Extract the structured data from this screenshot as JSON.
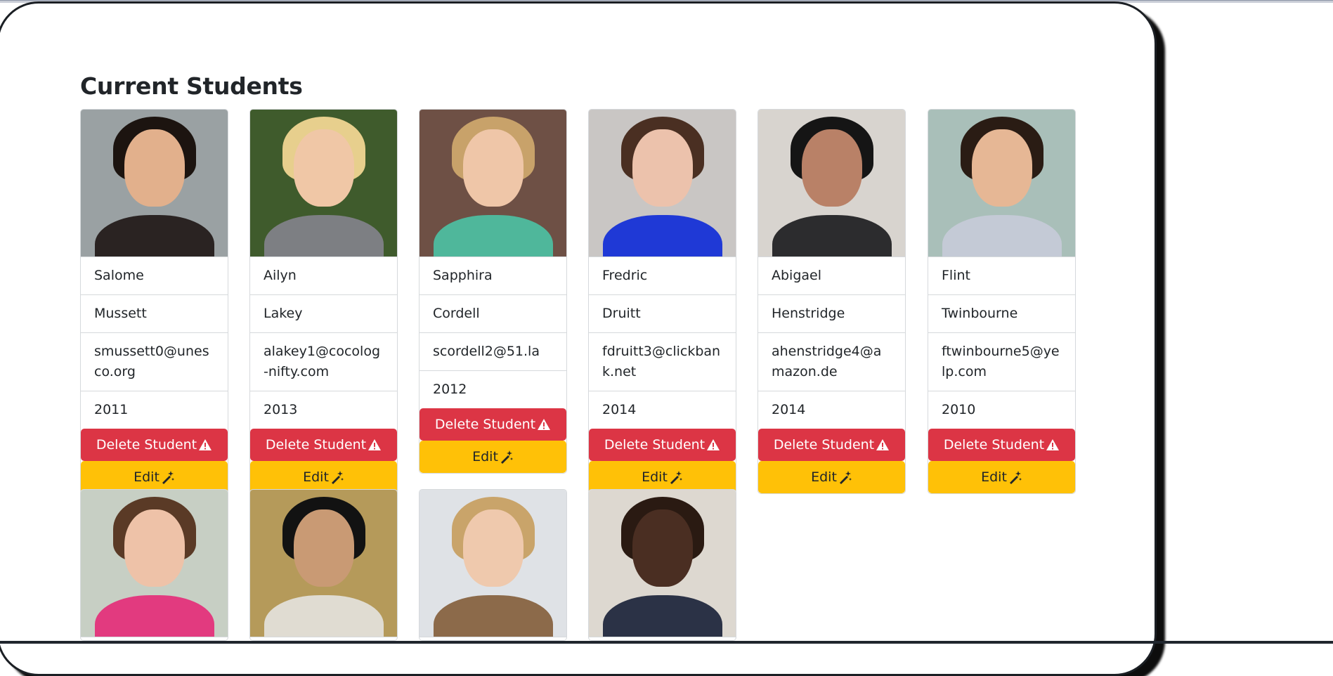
{
  "page": {
    "title": "Current Students"
  },
  "buttons": {
    "delete_label": "Delete Student",
    "edit_label": "Edit"
  },
  "icons": {
    "delete": "warning-triangle-icon",
    "edit": "magic-wand-icon"
  },
  "colors": {
    "danger": "#dc3545",
    "warning": "#ffc107",
    "text": "#212529"
  },
  "students": [
    {
      "first": "Salome",
      "last": "Mussett",
      "email": "smussett0@unesco.org",
      "year": "2011"
    },
    {
      "first": "Ailyn",
      "last": "Lakey",
      "email": "alakey1@cocolog-nifty.com",
      "year": "2013"
    },
    {
      "first": "Sapphira",
      "last": "Cordell",
      "email": "scordell2@51.la",
      "year": "2012"
    },
    {
      "first": "Fredric",
      "last": "Druitt",
      "email": "fdruitt3@clickbank.net",
      "year": "2014"
    },
    {
      "first": "Abigael",
      "last": "Henstridge",
      "email": "ahenstridge4@amazon.de",
      "year": "2014"
    },
    {
      "first": "Flint",
      "last": "Twinbourne",
      "email": "ftwinbourne5@yelp.com",
      "year": "2010"
    }
  ]
}
